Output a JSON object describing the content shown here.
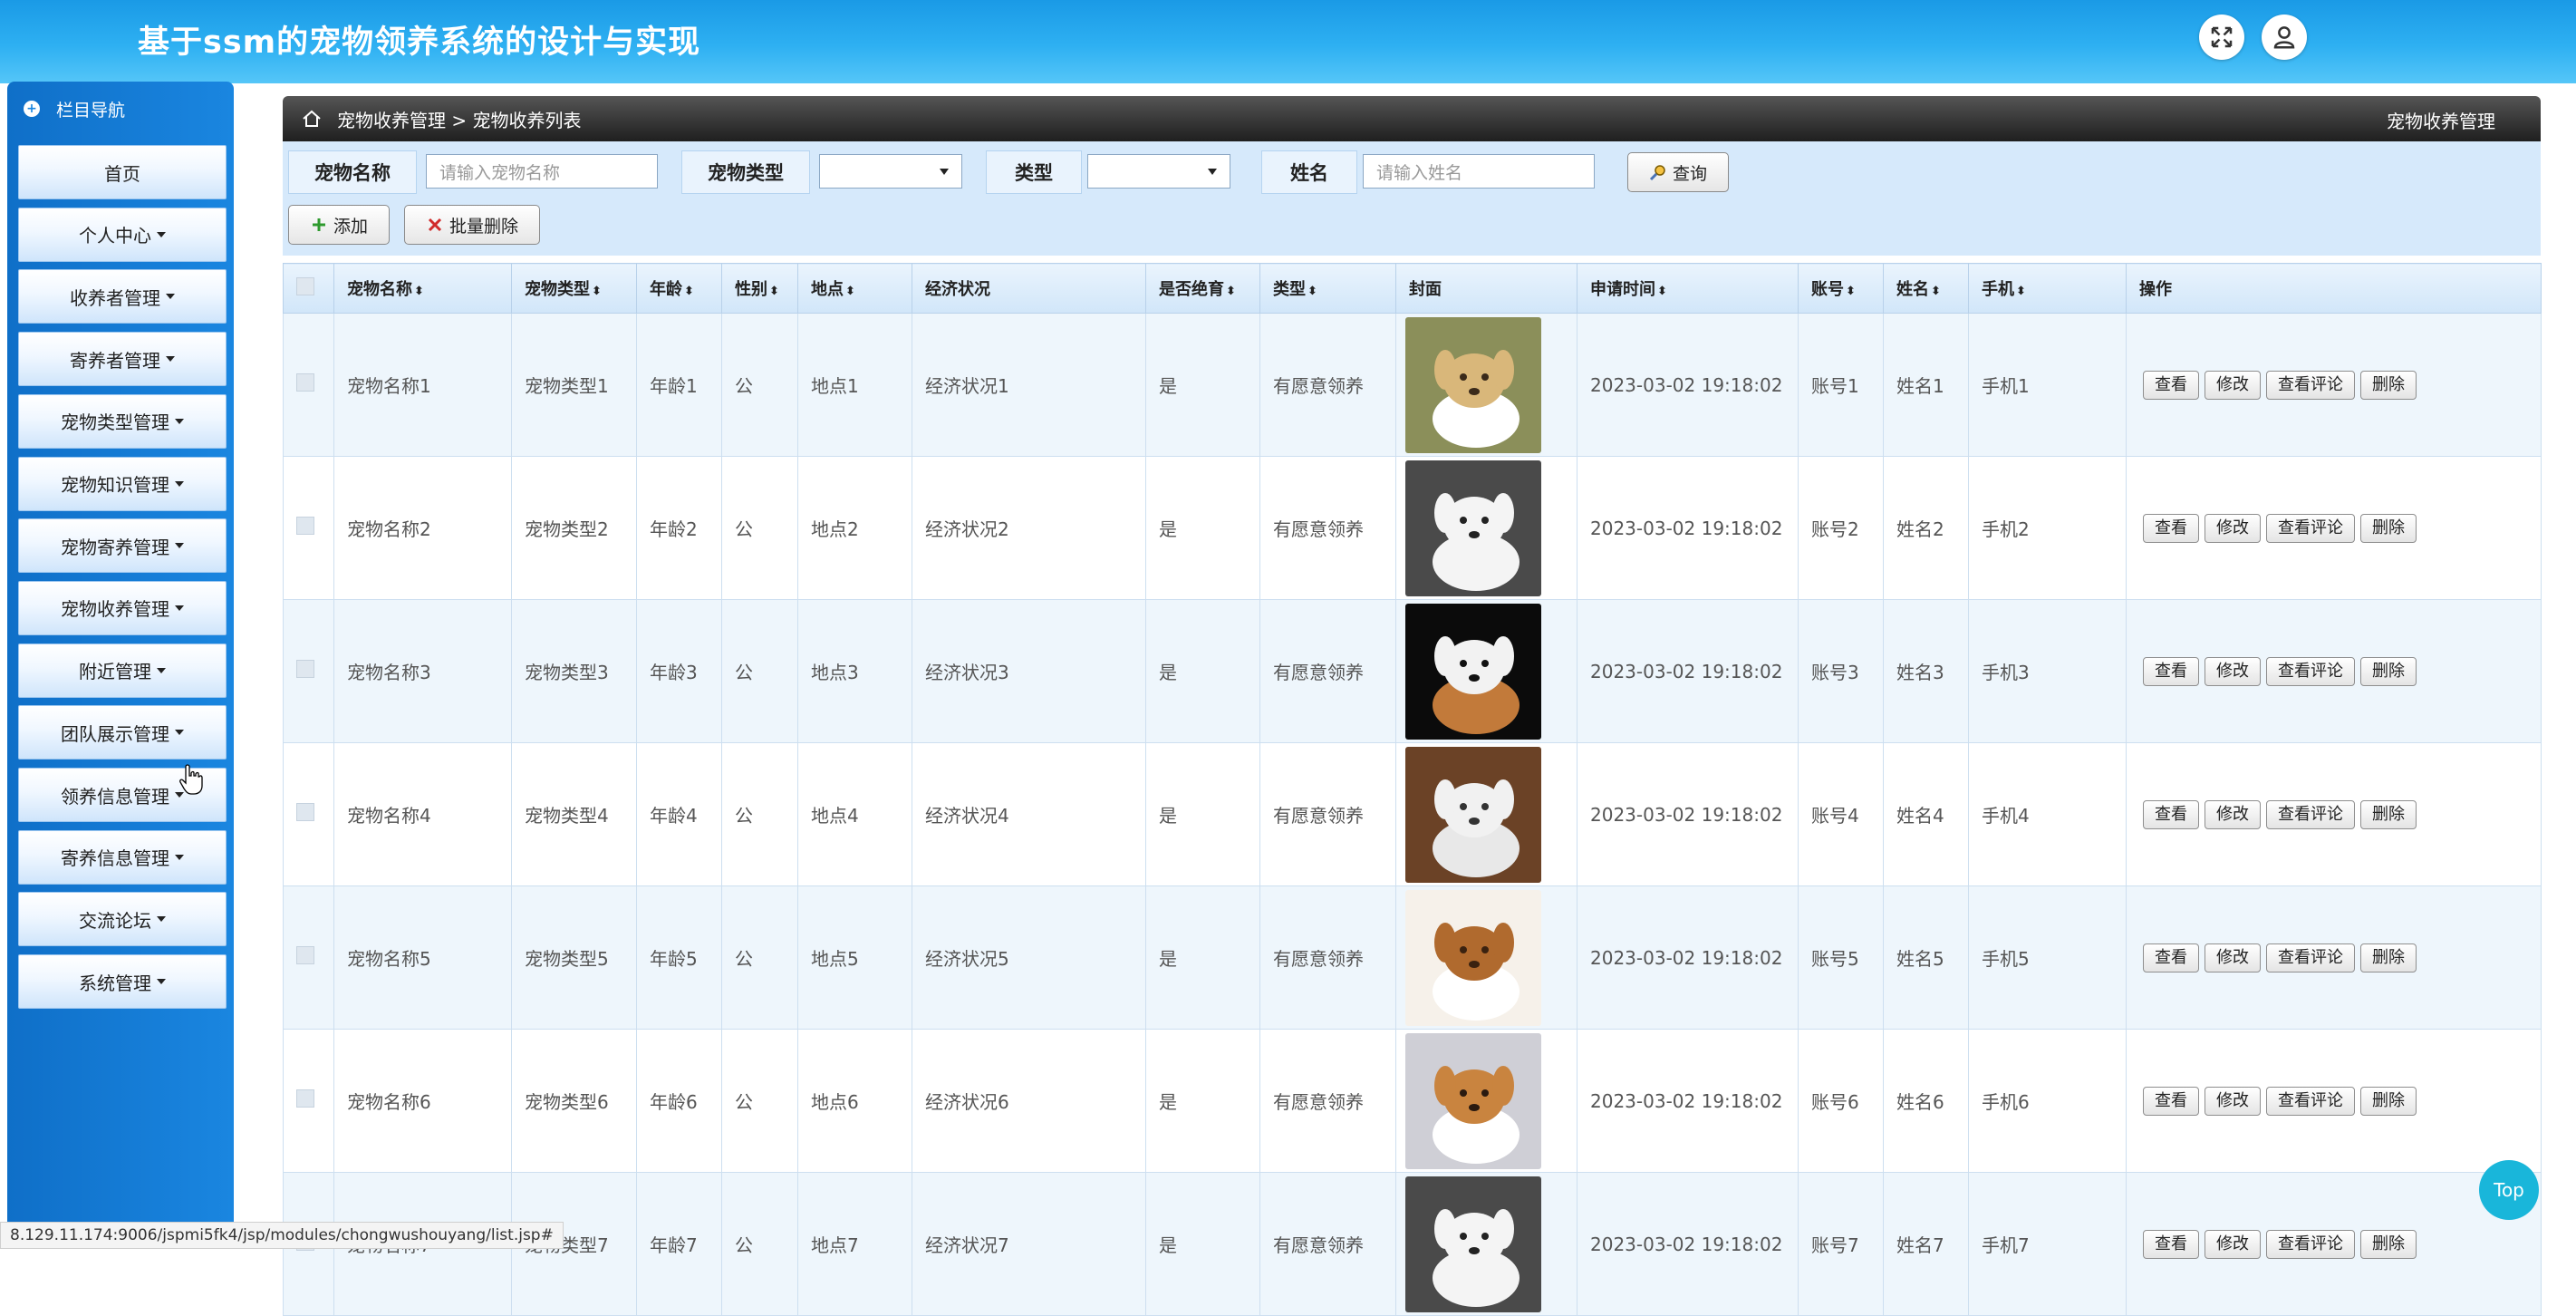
{
  "header": {
    "title": "基于ssm的宠物领养系统的设计与实现",
    "fullscreen_icon": "expand-icon",
    "user_icon": "user-icon"
  },
  "sidebar": {
    "title": "栏目导航",
    "items": [
      {
        "label": "首页",
        "has_caret": false
      },
      {
        "label": "个人中心",
        "has_caret": true
      },
      {
        "label": "收养者管理",
        "has_caret": true
      },
      {
        "label": "寄养者管理",
        "has_caret": true
      },
      {
        "label": "宠物类型管理",
        "has_caret": true
      },
      {
        "label": "宠物知识管理",
        "has_caret": true
      },
      {
        "label": "宠物寄养管理",
        "has_caret": true
      },
      {
        "label": "宠物收养管理",
        "has_caret": true
      },
      {
        "label": "附近管理",
        "has_caret": true
      },
      {
        "label": "团队展示管理",
        "has_caret": true
      },
      {
        "label": "领养信息管理",
        "has_caret": true
      },
      {
        "label": "寄养信息管理",
        "has_caret": true
      },
      {
        "label": "交流论坛",
        "has_caret": true
      },
      {
        "label": "系统管理",
        "has_caret": true
      }
    ]
  },
  "breadcrumb": {
    "path": "宠物收养管理 > 宠物收养列表",
    "right": "宠物收养管理"
  },
  "search": {
    "name_label": "宠物名称",
    "name_placeholder": "请输入宠物名称",
    "type_label": "宠物类型",
    "type_value": "",
    "kind_label": "类型",
    "kind_value": "",
    "person_label": "姓名",
    "person_placeholder": "请输入姓名",
    "query_button": "查询"
  },
  "actions": {
    "add": "添加",
    "batch_delete": "批量删除"
  },
  "table": {
    "headers": [
      "宠物名称",
      "宠物类型",
      "年龄",
      "性别",
      "地点",
      "经济状况",
      "是否绝育",
      "类型",
      "封面",
      "申请时间",
      "账号",
      "姓名",
      "手机",
      "操作"
    ],
    "sortable": [
      true,
      true,
      true,
      true,
      true,
      false,
      true,
      true,
      false,
      true,
      true,
      true,
      true,
      false
    ],
    "row_actions": [
      "查看",
      "修改",
      "查看评论",
      "删除"
    ],
    "rows": [
      {
        "name": "宠物名称1",
        "type": "宠物类型1",
        "age": "年龄1",
        "sex": "公",
        "place": "地点1",
        "econ": "经济状况1",
        "neutered": "是",
        "kind": "有愿意领养",
        "time": "2023-03-02 19:18:02",
        "account": "账号1",
        "person": "姓名1",
        "phone": "手机1",
        "cover": "dog-with-hat"
      },
      {
        "name": "宠物名称2",
        "type": "宠物类型2",
        "age": "年龄2",
        "sex": "公",
        "place": "地点2",
        "econ": "经济状况2",
        "neutered": "是",
        "kind": "有愿意领养",
        "time": "2023-03-02 19:18:02",
        "account": "账号2",
        "person": "姓名2",
        "phone": "手机2",
        "cover": "white-poodle"
      },
      {
        "name": "宠物名称3",
        "type": "宠物类型3",
        "age": "年龄3",
        "sex": "公",
        "place": "地点3",
        "econ": "经济状况3",
        "neutered": "是",
        "kind": "有愿意领养",
        "time": "2023-03-02 19:18:02",
        "account": "账号3",
        "person": "姓名3",
        "phone": "手机3",
        "cover": "puppy-dark-bg"
      },
      {
        "name": "宠物名称4",
        "type": "宠物类型4",
        "age": "年龄4",
        "sex": "公",
        "place": "地点4",
        "econ": "经济状况4",
        "neutered": "是",
        "kind": "有愿意领养",
        "time": "2023-03-02 19:18:02",
        "account": "账号4",
        "person": "姓名4",
        "phone": "手机4",
        "cover": "white-cat"
      },
      {
        "name": "宠物名称5",
        "type": "宠物类型5",
        "age": "年龄5",
        "sex": "公",
        "place": "地点5",
        "econ": "经济状况5",
        "neutered": "是",
        "kind": "有愿意领养",
        "time": "2023-03-02 19:18:02",
        "account": "账号5",
        "person": "姓名5",
        "phone": "手机5",
        "cover": "spaniel-puppy"
      },
      {
        "name": "宠物名称6",
        "type": "宠物类型6",
        "age": "年龄6",
        "sex": "公",
        "place": "地点6",
        "econ": "经济状况6",
        "neutered": "是",
        "kind": "有愿意领养",
        "time": "2023-03-02 19:18:02",
        "account": "账号6",
        "person": "姓名6",
        "phone": "手机6",
        "cover": "papillon"
      },
      {
        "name": "宠物名称7",
        "type": "宠物类型7",
        "age": "年龄7",
        "sex": "公",
        "place": "地点7",
        "econ": "经济状况7",
        "neutered": "是",
        "kind": "有愿意领养",
        "time": "2023-03-02 19:18:02",
        "account": "账号7",
        "person": "姓名7",
        "phone": "手机7",
        "cover": "white-poodle"
      }
    ]
  },
  "status_url": "8.129.11.174:9006/jspmi5fk4/jsp/modules/chongwushouyang/list.jsp#",
  "top_button": "Top",
  "colors": {
    "header": "#1a9ae6",
    "sidebar": "#1a86e0",
    "accent": "#19b6da"
  }
}
